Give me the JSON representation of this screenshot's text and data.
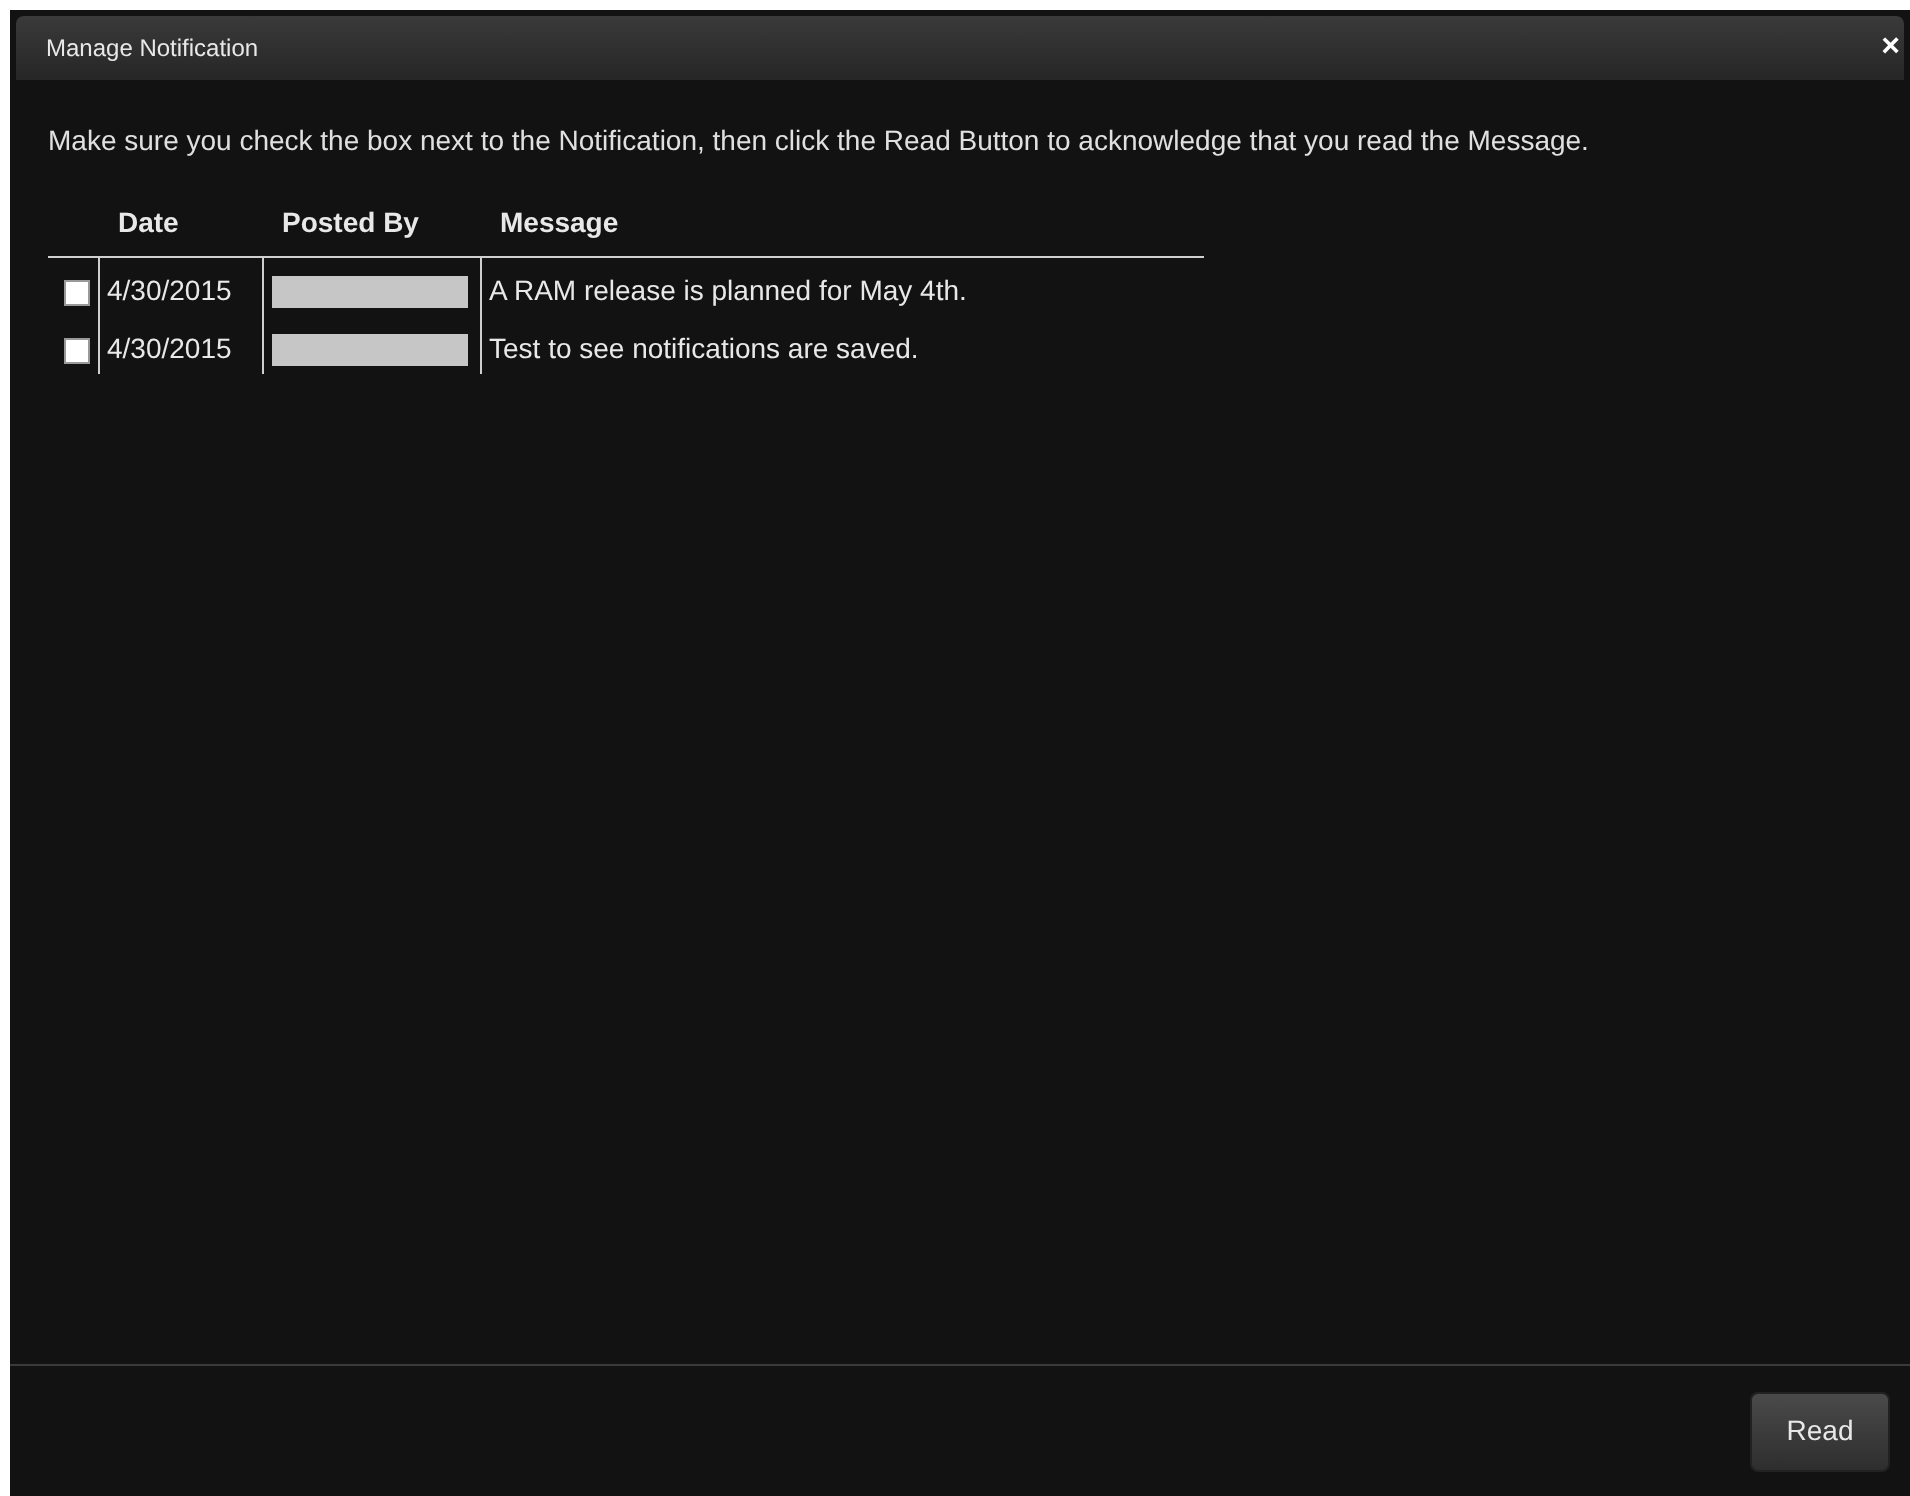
{
  "window": {
    "title": "Manage Notification",
    "close": "×"
  },
  "instructions": "Make sure you check the box next to the Notification, then click the Read Button to acknowledge that you read the Message.",
  "table": {
    "columns": [
      "Date",
      "Posted By",
      "Message"
    ],
    "rows": [
      {
        "checked": false,
        "date": "4/30/2015",
        "posted_by": {
          "kind": "redacted"
        },
        "message": "A RAM release is planned for May 4th."
      },
      {
        "checked": false,
        "date": "4/30/2015",
        "posted_by": {
          "kind": "redacted"
        },
        "message": "Test to see notifications are saved."
      }
    ]
  },
  "buttons": [
    "Read"
  ]
}
